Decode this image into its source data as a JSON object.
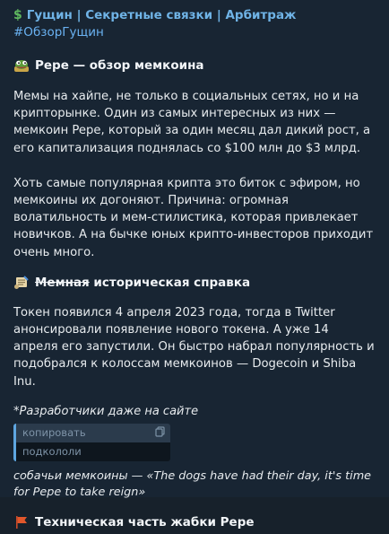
{
  "message": {
    "channel_name": "Гущин | Секретные связки | Арбитраж",
    "hashtag": "#ОбзорГущин",
    "heading1": "Pepe — обзор мемкоина",
    "para1": "Мемы на хайпе, не только в социальных сетях, но и на крипторынке. Один из самых интересных из них — мемкоин Pepe, который за один месяц дал дикий рост, а его капитализация поднялась со $100 млн до $3 млрд.",
    "para2": "Хоть самые популярная крипта это биток с эфиром, но мемкоины их догоняют. Причина: огромная волатильность и мем-стилистика, которая привлекает новичков. А на бычке юных крипто-инвесторов приходит очень много.",
    "heading2_strike": "Мемная",
    "heading2_rest": " историческая справка",
    "para3": "Токен появился 4 апреля 2023 года, тогда в Twitter анонсировали появление нового токена. А уже 14 апреля его запустили. Он быстро набрал популярность и подобрался к колоссам мемкоинов — Dogecoin и Shiba Inu.",
    "para4": "*Разработчики даже на сайте",
    "spoiler": {
      "copy_label": "копировать",
      "text": "подкололи"
    },
    "para5": "собачьи мемкоины — «The dogs have had their day, it's time for Pepe to take reign»",
    "heading3": "Техническая часть жабки Pepe"
  },
  "icons": {
    "channel": "dollar-icon",
    "heading1": "frog-icon",
    "heading2": "scroll-icon",
    "heading3": "flag-icon",
    "copy": "copy-icon"
  },
  "colors": {
    "background": "#17212b",
    "link": "#6ab2f2",
    "channel_name": "#6fb3e6"
  }
}
